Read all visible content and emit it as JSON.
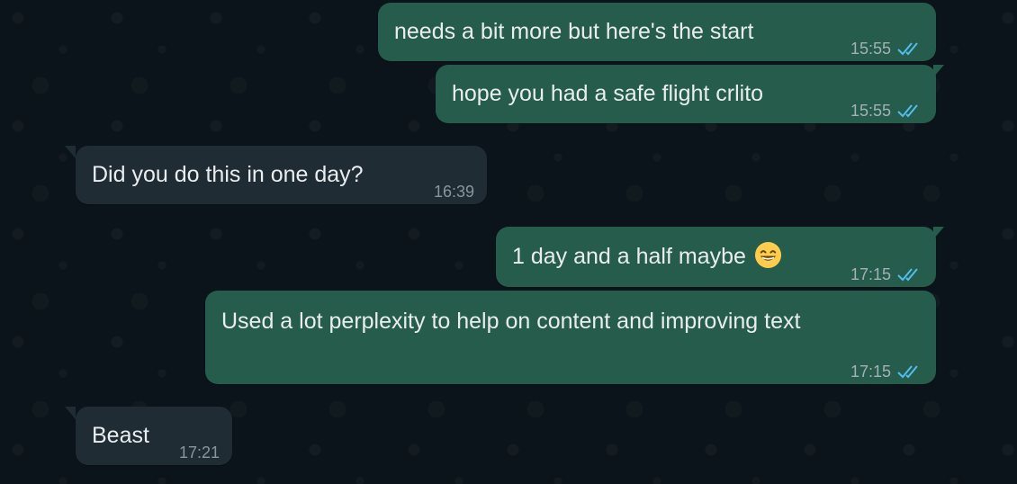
{
  "messages": [
    {
      "text": "needs a bit more but here's the start",
      "time": "15:55",
      "direction": "outgoing",
      "status": "read"
    },
    {
      "text": "hope you had a safe flight crlito",
      "time": "15:55",
      "direction": "outgoing",
      "status": "read"
    },
    {
      "text": "Did you do this in one day?",
      "time": "16:39",
      "direction": "incoming"
    },
    {
      "text": "1 day and a half maybe",
      "emoji": "grinning-face-with-smiling-eyes",
      "time": "17:15",
      "direction": "outgoing",
      "status": "read"
    },
    {
      "text": "Used a lot perplexity to help on content and improving text",
      "time": "17:15",
      "direction": "outgoing",
      "status": "read"
    },
    {
      "text": "Beast",
      "time": "17:21",
      "direction": "incoming"
    }
  ],
  "colors": {
    "background": "#0b141a",
    "outgoing_bubble": "#255c4b",
    "incoming_bubble": "#202c33",
    "text": "#e9edef",
    "read_ticks": "#53bdeb"
  }
}
